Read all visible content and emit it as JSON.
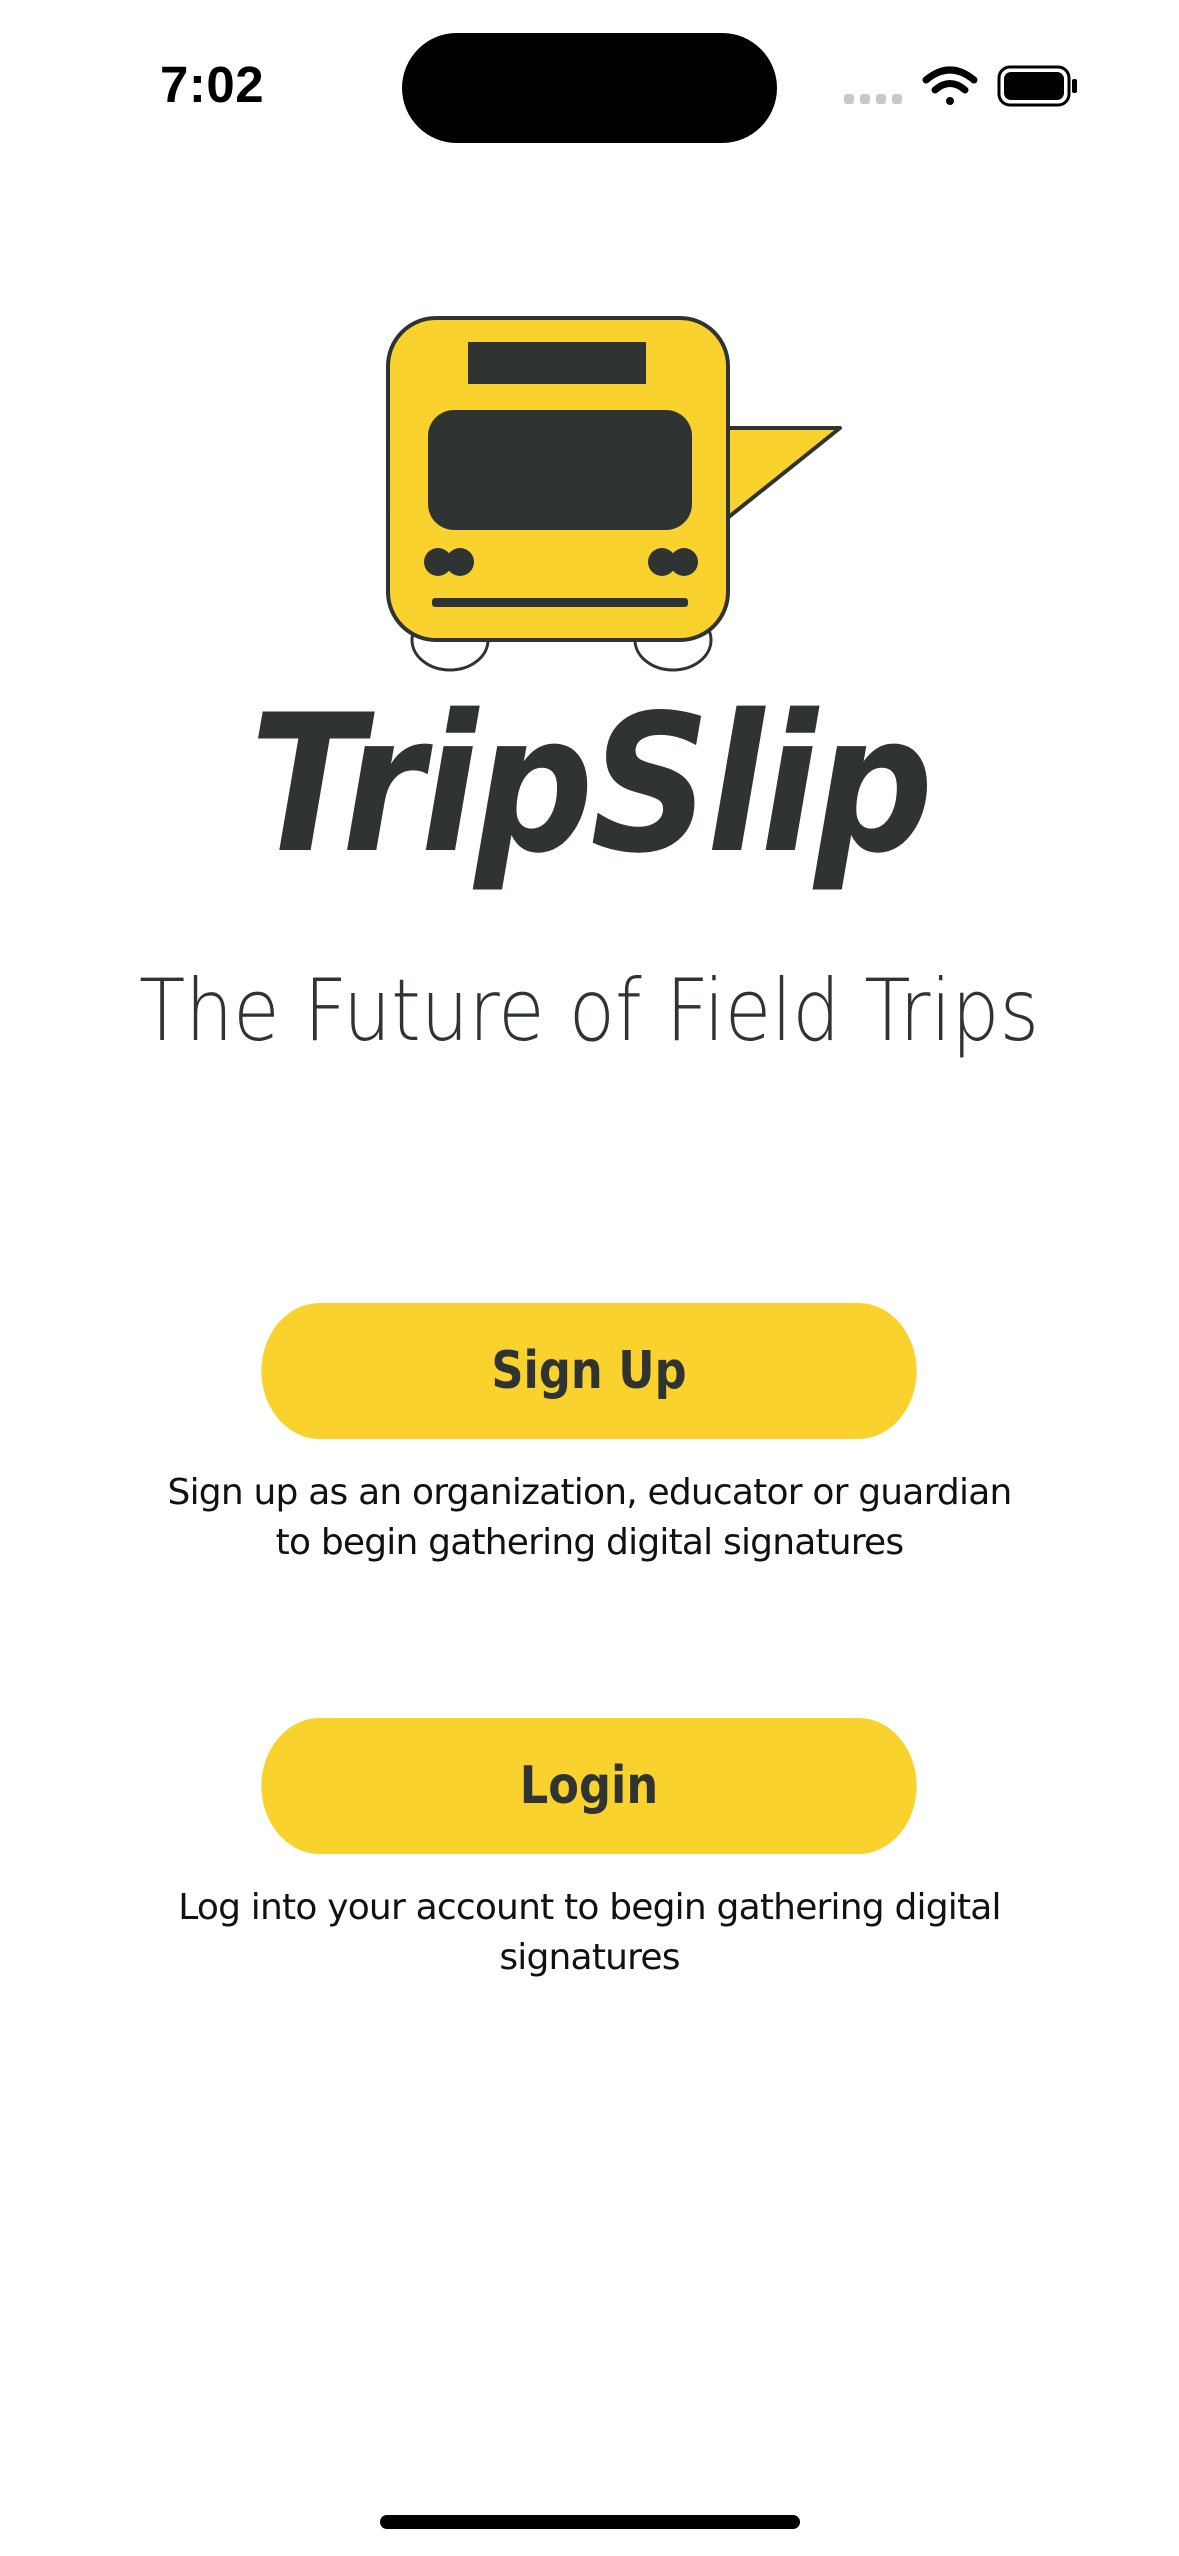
{
  "status_bar": {
    "time": "7:02"
  },
  "logo": {
    "name": "TripSlip",
    "tagline": "The Future of Field Trips",
    "colors": {
      "bus_yellow": "#fad22e",
      "dark": "#2f3433"
    }
  },
  "actions": {
    "signup": {
      "label": "Sign Up",
      "description": "Sign up as an organization, educator or guardian to begin gathering digital signatures"
    },
    "login": {
      "label": "Login",
      "description": "Log into your account to begin gathering digital signatures"
    }
  },
  "icons": [
    "cellular-signal-icon",
    "wifi-icon",
    "battery-icon"
  ]
}
